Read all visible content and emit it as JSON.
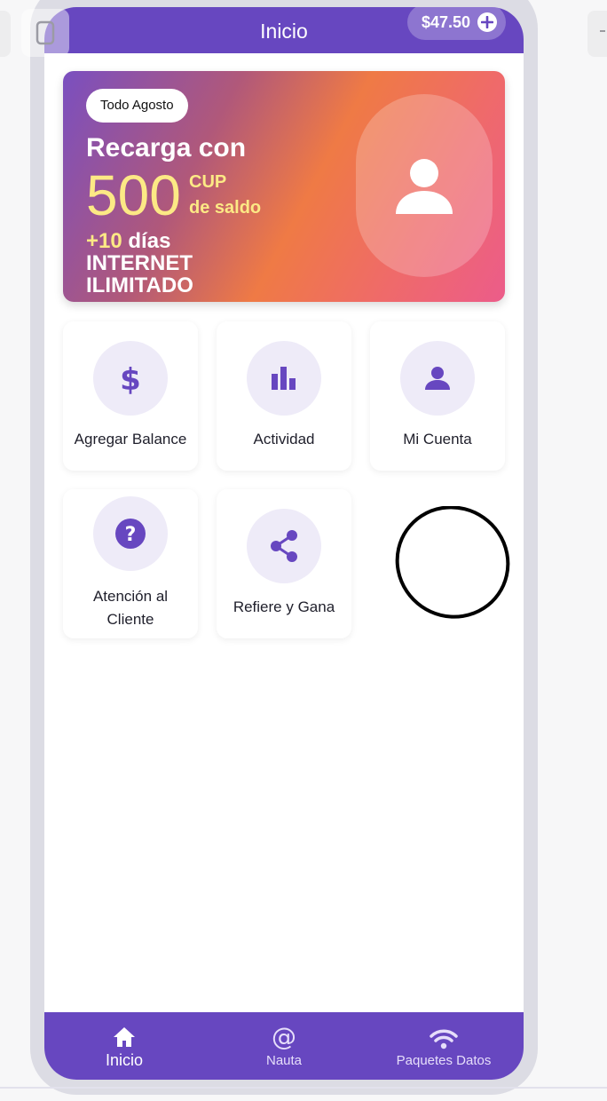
{
  "header": {
    "title": "Inicio",
    "balance": "$47.50"
  },
  "promo": {
    "tag": "Todo Agosto",
    "headline": "Recarga con",
    "amount": "500",
    "currency": "CUP",
    "saldo_label": "de saldo",
    "days_highlight": "+10",
    "days_label": "días",
    "internet": "INTERNET ILIMITADO"
  },
  "actions": [
    {
      "label": "Agregar Balance",
      "icon": "dollar-icon"
    },
    {
      "label": "Actividad",
      "icon": "bar-chart-icon"
    },
    {
      "label": "Mi Cuenta",
      "icon": "person-icon"
    },
    {
      "label": "Atención al Cliente",
      "icon": "help-icon"
    },
    {
      "label": "Refiere y Gana",
      "icon": "share-icon"
    }
  ],
  "nav": [
    {
      "label": "Inicio",
      "icon": "home-icon",
      "active": true
    },
    {
      "label": "Nauta",
      "icon": "at-icon",
      "active": false
    },
    {
      "label": "Paquetes Datos",
      "icon": "wifi-icon",
      "active": false
    }
  ],
  "colors": {
    "primary": "#6747c0",
    "icon_bg": "#eeebf8",
    "highlight": "#fce985"
  }
}
